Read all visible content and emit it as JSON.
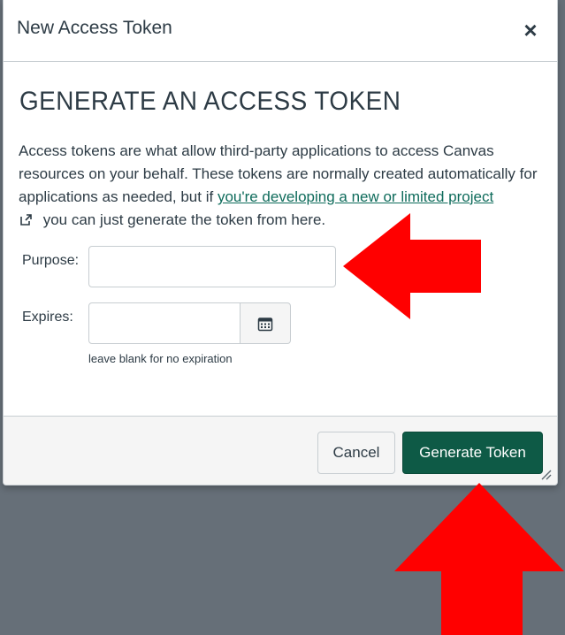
{
  "dialog": {
    "title": "New Access Token",
    "close_label": "×",
    "heading": "GENERATE AN ACCESS TOKEN",
    "description_before_link": "Access tokens are what allow third-party applications to access Canvas resources on your behalf. These tokens are normally created automatically for applications as needed, but if ",
    "description_link": "you're developing a new or limited project",
    "description_after_link": " you can just generate the token from here."
  },
  "form": {
    "purpose_label": "Purpose:",
    "purpose_value": "",
    "expires_label": "Expires:",
    "expires_value": "",
    "expires_hint": "leave blank for no expiration"
  },
  "footer": {
    "cancel_label": "Cancel",
    "generate_label": "Generate Token"
  },
  "colors": {
    "primary_button": "#0e5a46",
    "link": "#0e6b5b",
    "annotation_arrow": "#ff0000",
    "overlay": "#666f78"
  },
  "icons": [
    "close-icon",
    "external-link-icon",
    "calendar-icon",
    "resize-handle-icon",
    "arrow-left-annotation",
    "arrow-up-annotation"
  ]
}
